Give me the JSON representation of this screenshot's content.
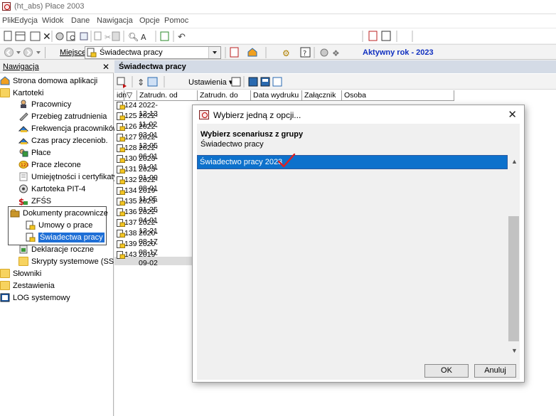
{
  "window": {
    "title": "(ht_abs) Płace 2003"
  },
  "menu": [
    "Plik",
    "Edycja",
    "Widok",
    "Dane",
    "Nawigacja",
    "Opcje",
    "Pomoc"
  ],
  "locationbar": {
    "label": "Miejsce",
    "value": "Świadectwa pracy",
    "active_year": "Aktywny rok - 2023"
  },
  "nav": {
    "title": "Nawigacja",
    "close": "✕",
    "items": [
      {
        "label": "Strona domowa aplikacji",
        "icon": "home-icon"
      },
      {
        "label": "Kartoteki",
        "icon": "folder-icon"
      },
      {
        "label": "Pracownicy",
        "icon": "employees-icon"
      },
      {
        "label": "Przebieg zatrudnienia",
        "icon": "employment-history-icon"
      },
      {
        "label": "Frekwencja pracowników",
        "icon": "attendance-icon"
      },
      {
        "label": "Czas pracy zleceniob.",
        "icon": "work-time-icon"
      },
      {
        "label": "Płace",
        "icon": "payroll-icon"
      },
      {
        "label": "Prace zlecone",
        "icon": "commissioned-work-icon"
      },
      {
        "label": "Umiejętności i certyfikaty",
        "icon": "certificate-icon"
      },
      {
        "label": "Kartoteka PIT-4",
        "icon": "pit4-icon"
      },
      {
        "label": "ZFŚS",
        "icon": "fund-icon"
      },
      {
        "label": "Dokumenty pracownicze",
        "icon": "documents-icon"
      },
      {
        "label": "Umowy o prace",
        "icon": "contract-icon"
      },
      {
        "label": "Świadectwa pracy",
        "icon": "certificate-doc-icon"
      },
      {
        "label": "Deklaracje roczne",
        "icon": "declaration-icon"
      },
      {
        "label": "Skrypty systemowe (SSH)",
        "icon": "folder-icon"
      },
      {
        "label": "Słowniki",
        "icon": "folder-icon"
      },
      {
        "label": "Zestawienia",
        "icon": "folder-icon"
      },
      {
        "label": "LOG systemowy",
        "icon": "log-icon"
      }
    ]
  },
  "panel": {
    "title": "Świadectwa pracy",
    "settings_label": "Ustawienia ▾",
    "columns": [
      "idn",
      "Zatrudn. od",
      "Zatrudn. do",
      "Data wydruku",
      "Załącznik",
      "Osoba"
    ],
    "rows": [
      {
        "idn": "124",
        "date_from": "2022-12-13"
      },
      {
        "idn": "125",
        "date_from": "2022-11-02"
      },
      {
        "idn": "126",
        "date_from": "2022-03-01"
      },
      {
        "idn": "127",
        "date_from": "2022-12-05"
      },
      {
        "idn": "128",
        "date_from": "2022-06-01"
      },
      {
        "idn": "130",
        "date_from": "2023-01-01"
      },
      {
        "idn": "131",
        "date_from": "2023-01-09"
      },
      {
        "idn": "132",
        "date_from": "2022-08-01"
      },
      {
        "idn": "134",
        "date_from": "2019-11-05"
      },
      {
        "idn": "135",
        "date_from": "2023-01-25"
      },
      {
        "idn": "136",
        "date_from": "2022-04-01"
      },
      {
        "idn": "137",
        "date_from": "2022-12-21"
      },
      {
        "idn": "138",
        "date_from": "2020-08-17"
      },
      {
        "idn": "139",
        "date_from": "2020-08-17"
      },
      {
        "idn": "143",
        "date_from": "2019-09-02"
      }
    ]
  },
  "dialog": {
    "title": "Wybierz jedną z opcji...",
    "close": "✕",
    "heading": "Wybierz scenariusz z grupy",
    "group": "Świadectwo pracy",
    "options": [
      "Świadectwo pracy 2023"
    ],
    "ok": "OK",
    "cancel": "Anuluj",
    "checkmark_color": "#e02020",
    "selection_color": "#0d71cc"
  }
}
